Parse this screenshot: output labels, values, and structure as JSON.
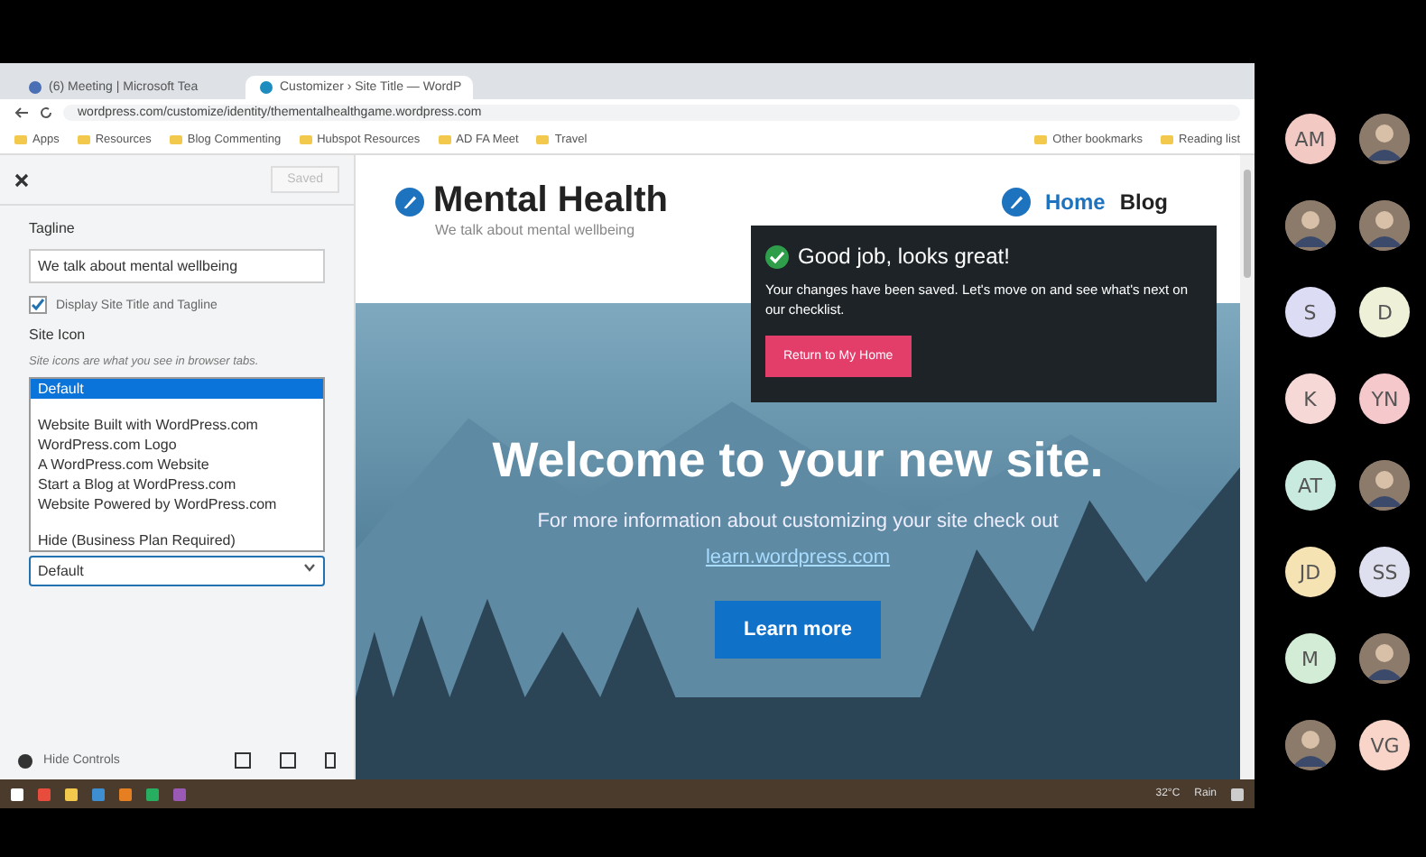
{
  "browser": {
    "tabs": [
      {
        "title": "(6) Meeting | Microsoft Tea",
        "selected": false
      },
      {
        "title": "Customizer › Site Title — WordP",
        "selected": true
      }
    ],
    "url": "wordpress.com/customize/identity/thementalhealthgame.wordpress.com",
    "bookmarks": [
      "Apps",
      "Resources",
      "Blog Commenting",
      "Hubspot Resources",
      "AD FA Meet",
      "Travel"
    ],
    "bookmarks_right": [
      "Other bookmarks",
      "Reading list"
    ]
  },
  "customizer": {
    "save_label": "Saved",
    "tagline_label": "Tagline",
    "tagline_value": "We talk about mental wellbeing",
    "display_title": {
      "label": "Display Site Title and Tagline",
      "checked": true
    },
    "site_icon_title": "Site Icon",
    "site_icon_help": "Site icons are what you see in browser tabs.",
    "options": [
      {
        "label": "Default",
        "selected": true
      },
      {
        "label": "Website Built with WordPress.com",
        "selected": false
      },
      {
        "label": "WordPress.com Logo",
        "selected": false
      },
      {
        "label": "A WordPress.com Website",
        "selected": false
      },
      {
        "label": "Start a Blog at WordPress.com",
        "selected": false
      },
      {
        "label": "Website Powered by WordPress.com",
        "selected": false
      },
      {
        "label": "Hide (Business Plan Required)",
        "selected": false
      }
    ],
    "select_value": "Default",
    "hide_controls": "Hide Controls"
  },
  "site": {
    "title": "Mental Health",
    "tagline": "We talk about mental wellbeing",
    "nav": [
      {
        "label": "Home",
        "selected": true
      },
      {
        "label": "Blog",
        "selected": false
      }
    ],
    "hero_title": "Welcome to your new site.",
    "hero_text": "For more information about customizing your site check out",
    "hero_link": "learn.wordpress.com",
    "hero_button": "Learn more"
  },
  "notice": {
    "title": "Good job, looks great!",
    "text": "Your changes have been saved. Let's move on and see what's next on our checklist.",
    "button": "Return to My Home"
  },
  "taskbar": {
    "weather": "32°C",
    "condition": "Rain"
  },
  "participants": [
    {
      "kind": "initials",
      "initials": "AM",
      "color": "#f3c9c4"
    },
    {
      "kind": "photo"
    },
    {
      "kind": "photo"
    },
    {
      "kind": "photo"
    },
    {
      "kind": "initials",
      "initials": "S",
      "color": "#dcdcf4"
    },
    {
      "kind": "initials",
      "initials": "D",
      "color": "#eef0d8"
    },
    {
      "kind": "initials",
      "initials": "K",
      "color": "#f6d8d6"
    },
    {
      "kind": "initials",
      "initials": "YN",
      "color": "#f5c8cc"
    },
    {
      "kind": "initials",
      "initials": "AT",
      "color": "#c9eadf"
    },
    {
      "kind": "photo"
    },
    {
      "kind": "initials",
      "initials": "JD",
      "color": "#f6e3b4"
    },
    {
      "kind": "initials",
      "initials": "SS",
      "color": "#dfe0ef"
    },
    {
      "kind": "initials",
      "initials": "M",
      "color": "#d3ecd6"
    },
    {
      "kind": "photo"
    },
    {
      "kind": "photo"
    },
    {
      "kind": "initials",
      "initials": "VG",
      "color": "#f8d5c8"
    }
  ]
}
